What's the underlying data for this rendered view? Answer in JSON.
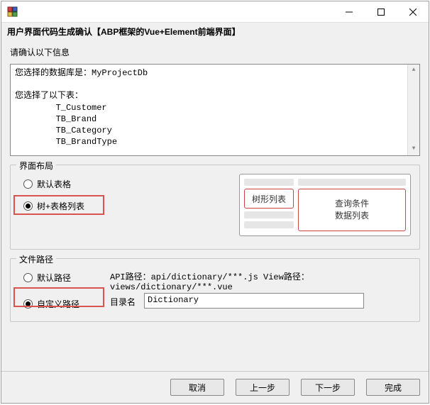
{
  "window": {
    "title": "用户界面代码生成确认【ABP框架的Vue+Element前端界面】"
  },
  "confirm_label": "请确认以下信息",
  "info_text": "您选择的数据库是：MyProjectDb\n\n您选择了以下表：\n        T_Customer\n        TB_Brand\n        TB_Category\n        TB_BrandType\n\n您选择生成的路径为：c:\\output",
  "layout": {
    "group_title": "界面布局",
    "option_default": "默认表格",
    "option_tree": "树+表格列表",
    "preview_left": "树形列表",
    "preview_right_line1": "查询条件",
    "preview_right_line2": "数据列表"
  },
  "path": {
    "group_title": "文件路径",
    "option_default": "默认路径",
    "option_custom": "自定义路径",
    "api_view_label": "API路径：api/dictionary/***.js  View路径：views/dictionary/***.vue",
    "dir_label": "目录名",
    "dir_value": "Dictionary"
  },
  "buttons": {
    "cancel": "取消",
    "prev": "上一步",
    "next": "下一步",
    "finish": "完成"
  }
}
